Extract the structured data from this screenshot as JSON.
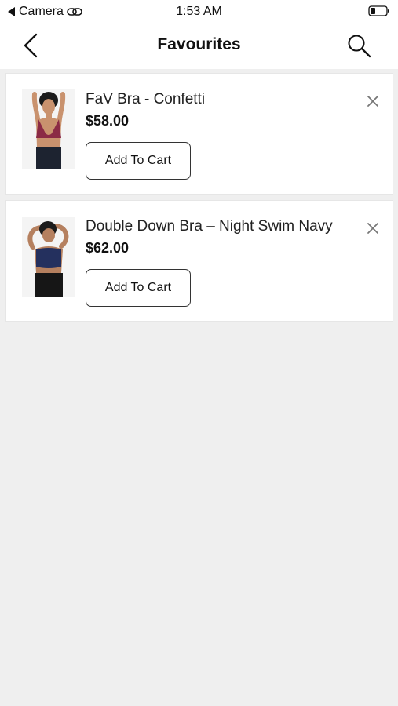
{
  "status_bar": {
    "back_app": "Camera",
    "time": "1:53 AM"
  },
  "header": {
    "title": "Favourites",
    "back_icon": "chevron-left-icon",
    "search_icon": "search-icon"
  },
  "favourites": [
    {
      "name": "FaV Bra - Confetti",
      "price": "$58.00",
      "button_label": "Add To Cart",
      "bra_color": "#8b2a45"
    },
    {
      "name": "Double Down Bra – Night Swim Navy",
      "price": "$62.00",
      "button_label": "Add To Cart",
      "bra_color": "#24305e"
    }
  ],
  "colors": {
    "background": "#efefef",
    "card": "#ffffff",
    "text": "#111111"
  }
}
